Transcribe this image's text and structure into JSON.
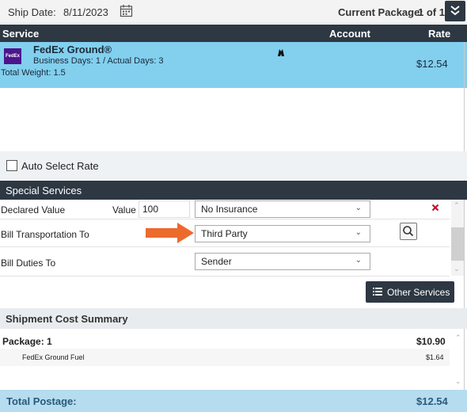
{
  "topbar": {
    "ship_date_label": "Ship Date:",
    "ship_date": "8/11/2023",
    "current_package_label": "Current Package:",
    "current_package_value": "1 of 1"
  },
  "table_header": {
    "service": "Service",
    "account": "Account",
    "rate": "Rate"
  },
  "rate_row": {
    "carrier_logo": "FedEx",
    "service_name": "FedEx Ground®",
    "days": "Business Days: 1  /  Actual Days: 3",
    "weight": "Total Weight: 1.5",
    "rate": "$12.54"
  },
  "auto_select": {
    "label": "Auto Select Rate",
    "checked": false
  },
  "special_services": {
    "title": "Special Services",
    "declared_value_label": "Declared Value",
    "value_label": "Value",
    "value": "100",
    "insurance": "No Insurance",
    "bill_transport_label": "Bill Transportation To",
    "bill_transport_value": "Third Party",
    "bill_duties_label": "Bill Duties To",
    "bill_duties_value": "Sender",
    "other_services_label": "Other Services"
  },
  "summary": {
    "title": "Shipment Cost Summary",
    "package_label": "Package: 1",
    "package_value": "$10.90",
    "fuel_label": "FedEx Ground Fuel",
    "fuel_value": "$1.64",
    "total_label": "Total Postage:",
    "total_value": "$12.54"
  },
  "colors": {
    "header_bg": "#2d3843",
    "selected_row": "#82cfee",
    "arrow": "#ec6a2c",
    "total_bg": "#b5dcef",
    "remove": "#c8102e"
  },
  "icons": [
    "calendar-icon",
    "expand-icon",
    "account-icon",
    "remove-icon",
    "search-icon",
    "list-icon",
    "arrow-icon"
  ]
}
